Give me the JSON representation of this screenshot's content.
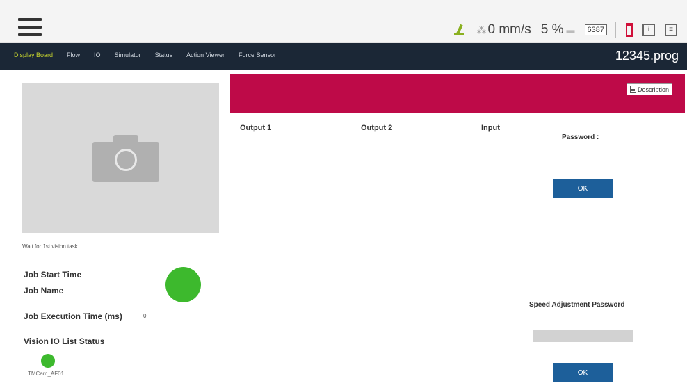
{
  "topbar": {
    "speed": "0 mm/s",
    "percent": "5 %",
    "counter": "6387"
  },
  "nav": {
    "tabs": [
      {
        "label": "Display Board"
      },
      {
        "label": "Flow"
      },
      {
        "label": "IO"
      },
      {
        "label": "Simulator"
      },
      {
        "label": "Status"
      },
      {
        "label": "Action Viewer"
      },
      {
        "label": "Force Sensor"
      }
    ],
    "program_name": "12345.prog"
  },
  "left": {
    "wait_text": "Wait for 1st vision task...",
    "job_start_time_label": "Job Start Time",
    "job_name_label": "Job Name",
    "job_exec_time_label": "Job Execution Time (ms)",
    "job_exec_time_value": "0",
    "vision_io_label": "Vision IO List Status",
    "tmcam_label": "TMCam_AF01",
    "status_color": "#3db92d"
  },
  "banner": {
    "color": "#be0a48",
    "description_label": "Description"
  },
  "columns": {
    "output1": "Output 1",
    "output2": "Output 2",
    "input": "Input"
  },
  "password": {
    "label": "Password :",
    "ok_label": "OK",
    "speed_label": "Speed Adjustment Password",
    "speed_ok_label": "OK"
  },
  "icons": {
    "menu": "hamburger-icon",
    "arm": "robot-arm-icon",
    "speed": "speed-icon",
    "gauge": "gauge-icon",
    "battery": "emergency-icon",
    "info": "info-icon",
    "panel": "panel-icon",
    "camera": "camera-icon"
  }
}
